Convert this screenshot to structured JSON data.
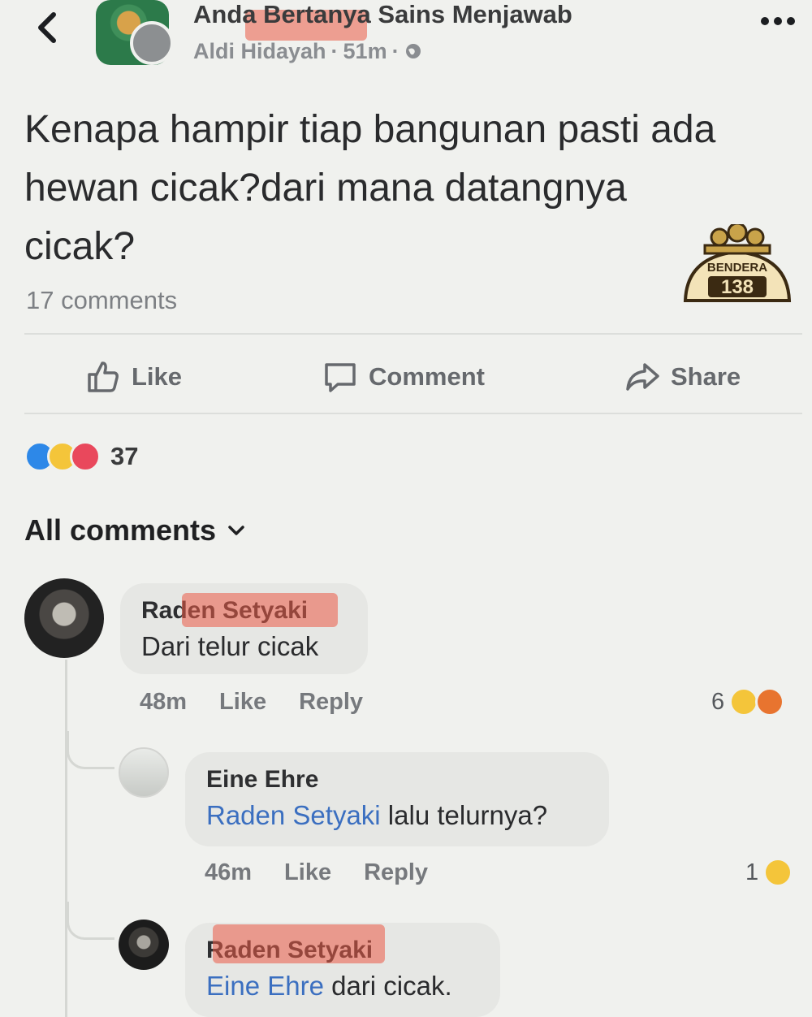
{
  "header": {
    "group_name": "Anda Bertanya Sains Menjawab",
    "poster_name": "Aldi Hidayah",
    "post_time": "51m",
    "separator": "·"
  },
  "post": {
    "text": "Kenapa hampir tiap bangunan pasti ada hewan cicak?dari mana datangnya cicak?",
    "comment_count": "17 comments"
  },
  "actions": {
    "like": "Like",
    "comment": "Comment",
    "share": "Share"
  },
  "reactions": {
    "icons": [
      "like",
      "haha",
      "love"
    ],
    "count": "37"
  },
  "comments_filter": "All comments",
  "comments": [
    {
      "author": "Raden Setyaki",
      "text": "Dari telur cicak",
      "time": "48m",
      "like": "Like",
      "reply": "Reply",
      "reaction_count": "6",
      "reaction_icons": [
        "haha",
        "angry"
      ]
    },
    {
      "author": "Eine Ehre",
      "mention": "Raden Setyaki",
      "text": " lalu telurnya?",
      "time": "46m",
      "like": "Like",
      "reply": "Reply",
      "reaction_count": "1",
      "reaction_icons": [
        "haha"
      ]
    },
    {
      "author": "Raden Setyaki",
      "mention": "Eine Ehre",
      "text": " dari cicak."
    }
  ],
  "watermark": {
    "top_text": "BENDERA",
    "number": "138"
  },
  "colors": {
    "background": "#f0f1ee",
    "mention": "#3b6fc0",
    "highlight": "#eb5a46",
    "like_reaction": "#2d88e8",
    "haha_reaction": "#f4c53a",
    "love_reaction": "#e9485c",
    "angry_reaction": "#e8742f"
  }
}
